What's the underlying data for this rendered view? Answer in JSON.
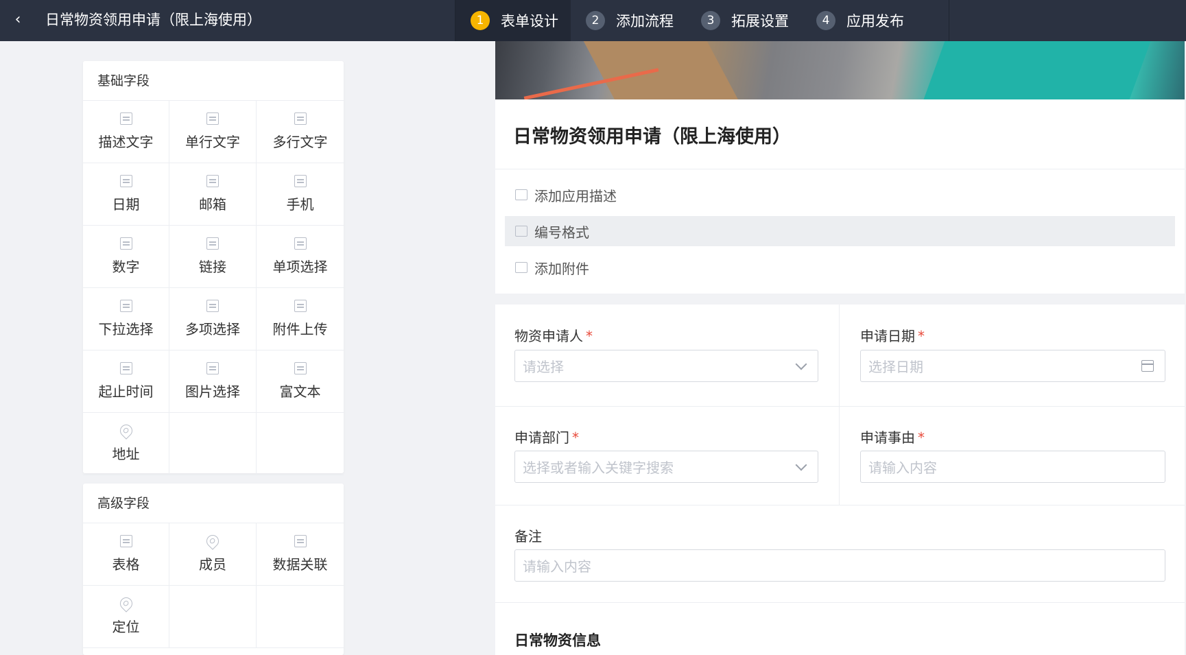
{
  "topbar": {
    "back_glyph": "‹",
    "title": "日常物资领用申请（限上海使用）",
    "steps": [
      {
        "num": "1",
        "label": "表单设计"
      },
      {
        "num": "2",
        "label": "添加流程"
      },
      {
        "num": "3",
        "label": "拓展设置"
      },
      {
        "num": "4",
        "label": "应用发布"
      }
    ],
    "active_step_color": "#f7b500"
  },
  "palette": {
    "basic": {
      "title": "基础字段",
      "items": [
        {
          "label": "描述文字",
          "icon": "description-icon"
        },
        {
          "label": "单行文字",
          "icon": "single-line-text-icon"
        },
        {
          "label": "多行文字",
          "icon": "multi-line-text-icon"
        },
        {
          "label": "日期",
          "icon": "calendar-icon"
        },
        {
          "label": "邮箱",
          "icon": "email-icon"
        },
        {
          "label": "手机",
          "icon": "phone-icon"
        },
        {
          "label": "数字",
          "icon": "number-icon"
        },
        {
          "label": "链接",
          "icon": "link-icon"
        },
        {
          "label": "单项选择",
          "icon": "radio-icon"
        },
        {
          "label": "下拉选择",
          "icon": "dropdown-icon"
        },
        {
          "label": "多项选择",
          "icon": "checkbox-icon"
        },
        {
          "label": "附件上传",
          "icon": "attachment-icon"
        },
        {
          "label": "起止时间",
          "icon": "time-range-icon"
        },
        {
          "label": "图片选择",
          "icon": "image-icon"
        },
        {
          "label": "富文本",
          "icon": "rich-text-icon"
        },
        {
          "label": "地址",
          "icon": "location-pin-icon"
        }
      ]
    },
    "advanced": {
      "title": "高级字段",
      "items": [
        {
          "label": "表格",
          "icon": "table-icon"
        },
        {
          "label": "成员",
          "icon": "member-icon"
        },
        {
          "label": "数据关联",
          "icon": "data-link-icon"
        },
        {
          "label": "定位",
          "icon": "location-pin-icon"
        }
      ]
    }
  },
  "form": {
    "title": "日常物资领用申请（限上海使用）",
    "options": [
      {
        "label": "添加应用描述",
        "icon": "comment-icon"
      },
      {
        "label": "编号格式",
        "icon": "number-format-icon"
      },
      {
        "label": "添加附件",
        "icon": "attachment-icon"
      }
    ],
    "fields": {
      "applicant": {
        "label": "物资申请人",
        "placeholder": "请选择"
      },
      "date": {
        "label": "申请日期",
        "placeholder": "选择日期"
      },
      "department": {
        "label": "申请部门",
        "placeholder": "选择或者输入关键字搜索"
      },
      "reason": {
        "label": "申请事由",
        "placeholder": "请输入内容"
      },
      "remark": {
        "label": "备注",
        "placeholder": "请输入内容"
      }
    },
    "required_mark": "*",
    "section_title": "日常物资信息"
  }
}
